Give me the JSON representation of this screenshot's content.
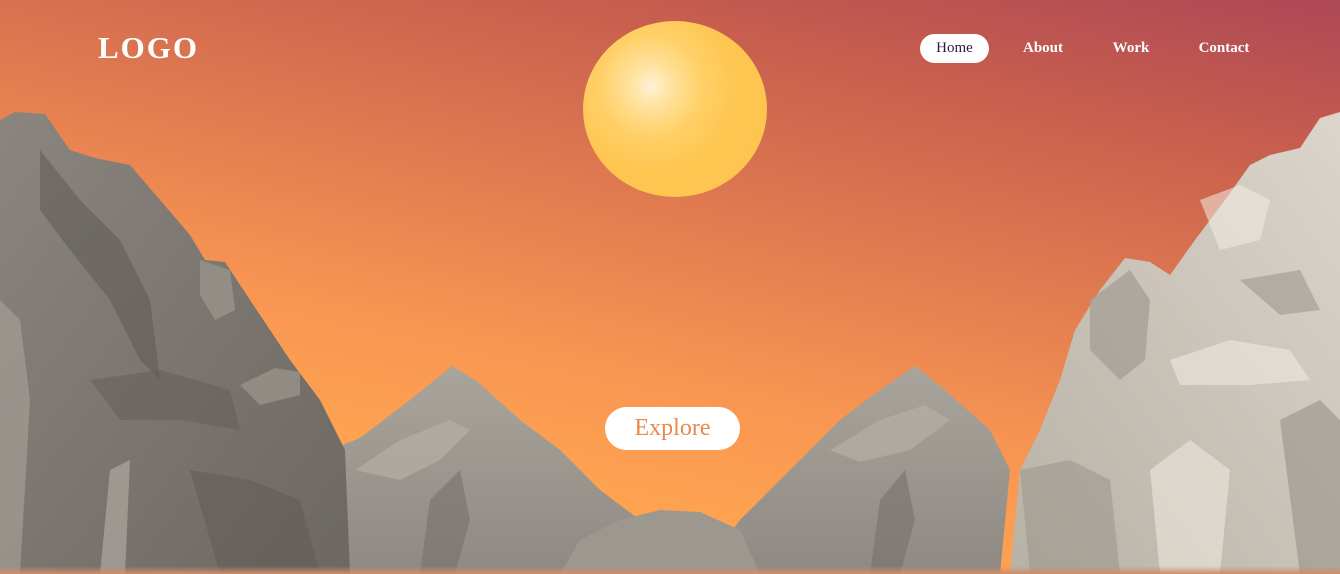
{
  "header": {
    "logo_text": "LOGO"
  },
  "nav": {
    "items": [
      {
        "label": "Home",
        "active": true
      },
      {
        "label": "About",
        "active": false
      },
      {
        "label": "Work",
        "active": false
      },
      {
        "label": "Contact",
        "active": false
      }
    ]
  },
  "hero": {
    "cta_label": "Explore"
  },
  "colors": {
    "sky_top": "#ad4856",
    "sky_bottom": "#ffac52",
    "sun": "#fec451",
    "rock_dark": "#6d6862",
    "rock_light": "#d8d1c6",
    "cta_text": "#e8884d"
  }
}
